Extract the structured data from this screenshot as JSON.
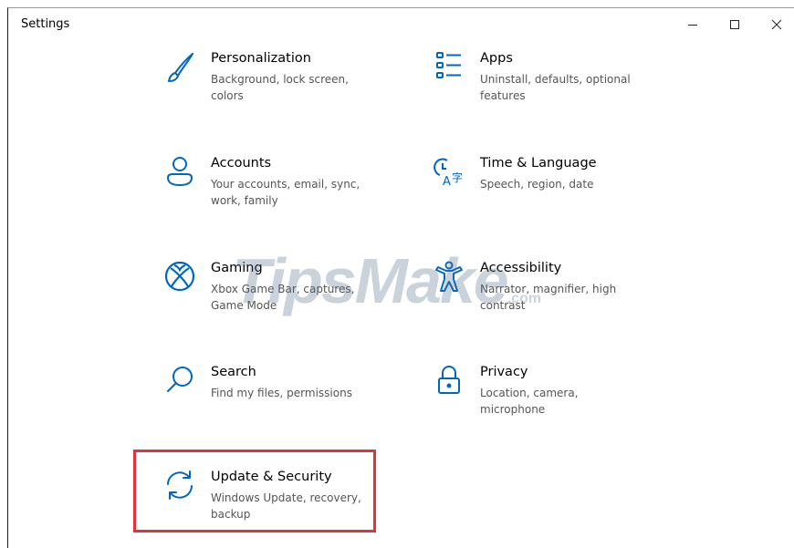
{
  "window": {
    "title": "Settings",
    "controls": [
      "minimize-icon",
      "maximize-icon",
      "close-icon"
    ]
  },
  "tiles": [
    {
      "name": "Personalization",
      "desc": "Background, lock screen, colors",
      "icon": "brush-icon"
    },
    {
      "name": "Apps",
      "desc": "Uninstall, defaults, optional features",
      "icon": "apps-list-icon"
    },
    {
      "name": "Accounts",
      "desc": "Your accounts, email, sync, work, family",
      "icon": "person-icon"
    },
    {
      "name": "Time & Language",
      "desc": "Speech, region, date",
      "icon": "time-language-icon"
    },
    {
      "name": "Gaming",
      "desc": "Xbox Game Bar, captures, Game Mode",
      "icon": "xbox-icon"
    },
    {
      "name": "Accessibility",
      "desc": "Narrator, magnifier, high contrast",
      "icon": "accessibility-icon"
    },
    {
      "name": "Search",
      "desc": "Find my files, permissions",
      "icon": "search-icon"
    },
    {
      "name": "Privacy",
      "desc": "Location, camera, microphone",
      "icon": "lock-icon"
    },
    {
      "name": "Update & Security",
      "desc": "Windows Update, recovery, backup",
      "icon": "sync-icon"
    }
  ],
  "watermark": {
    "text": "TipsMake",
    "suffix": ".com"
  },
  "colors": {
    "accent": "#0067c0",
    "highlight": "#e0333c"
  }
}
